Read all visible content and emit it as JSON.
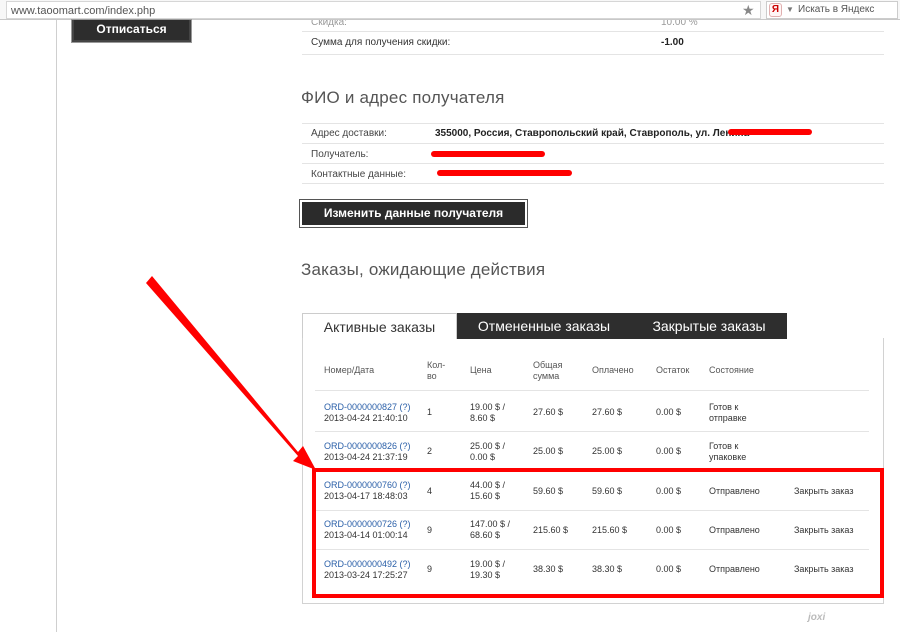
{
  "browser": {
    "url": "www.taoomart.com/index.php",
    "search_placeholder": "Искать в Яндекс",
    "yandex_logo": "Я"
  },
  "account": {
    "unsubscribe_label": "Отписаться"
  },
  "discount": {
    "cut_label": "Скидка:",
    "cut_value": "10.00 %",
    "sum_label": "Сумма для получения скидки:",
    "sum_value": "-1.00"
  },
  "recipient": {
    "title": "ФИО и адрес получателя",
    "address_label": "Адрес доставки:",
    "address_value": "355000, Россия, Ставропольский край, Ставрополь, ул. Ленина",
    "recipient_label": "Получатель:",
    "contacts_label": "Контактные данные:",
    "change_button": "Изменить данные получателя"
  },
  "orders": {
    "title": "Заказы, ожидающие действия",
    "tabs": [
      {
        "label": "Активные заказы",
        "active": true
      },
      {
        "label": "Отмененные заказы",
        "active": false
      },
      {
        "label": "Закрытые заказы",
        "active": false
      }
    ],
    "headers": {
      "number": "Номер/Дата",
      "qty1": "Кол-",
      "qty2": "во",
      "price": "Цена",
      "total1": "Общая",
      "total2": "сумма",
      "paid": "Оплачено",
      "rest": "Остаток",
      "status": "Состояние"
    },
    "rows": [
      {
        "id": "ORD-0000000827 (?)",
        "date": "2013-04-24 21:40:10",
        "qty": "1",
        "price1": "19.00 $ /",
        "price2": "8.60 $",
        "total": "27.60 $",
        "paid": "27.60 $",
        "rest": "0.00 $",
        "status1": "Готов к",
        "status2": "отправке",
        "action": ""
      },
      {
        "id": "ORD-0000000826 (?)",
        "date": "2013-04-24 21:37:19",
        "qty": "2",
        "price1": "25.00 $ /",
        "price2": "0.00 $",
        "total": "25.00 $",
        "paid": "25.00 $",
        "rest": "0.00 $",
        "status1": "Готов к",
        "status2": "упаковке",
        "action": ""
      },
      {
        "id": "ORD-0000000760 (?)",
        "date": "2013-04-17 18:48:03",
        "qty": "4",
        "price1": "44.00 $ /",
        "price2": "15.60 $",
        "total": "59.60 $",
        "paid": "59.60 $",
        "rest": "0.00 $",
        "status1": "Отправлено",
        "status2": "",
        "action": "Закрыть заказ"
      },
      {
        "id": "ORD-0000000726 (?)",
        "date": "2013-04-14 01:00:14",
        "qty": "9",
        "price1": "147.00 $ /",
        "price2": "68.60 $",
        "total": "215.60 $",
        "paid": "215.60 $",
        "rest": "0.00 $",
        "status1": "Отправлено",
        "status2": "",
        "action": "Закрыть заказ"
      },
      {
        "id": "ORD-0000000492 (?)",
        "date": "2013-03-24 17:25:27",
        "qty": "9",
        "price1": "19.00 $ /",
        "price2": "19.30 $",
        "total": "38.30 $",
        "paid": "38.30 $",
        "rest": "0.00 $",
        "status1": "Отправлено",
        "status2": "",
        "action": "Закрыть заказ"
      }
    ]
  },
  "annotations": {
    "highlight_color": "#ff0000",
    "watermark": "joxi"
  }
}
